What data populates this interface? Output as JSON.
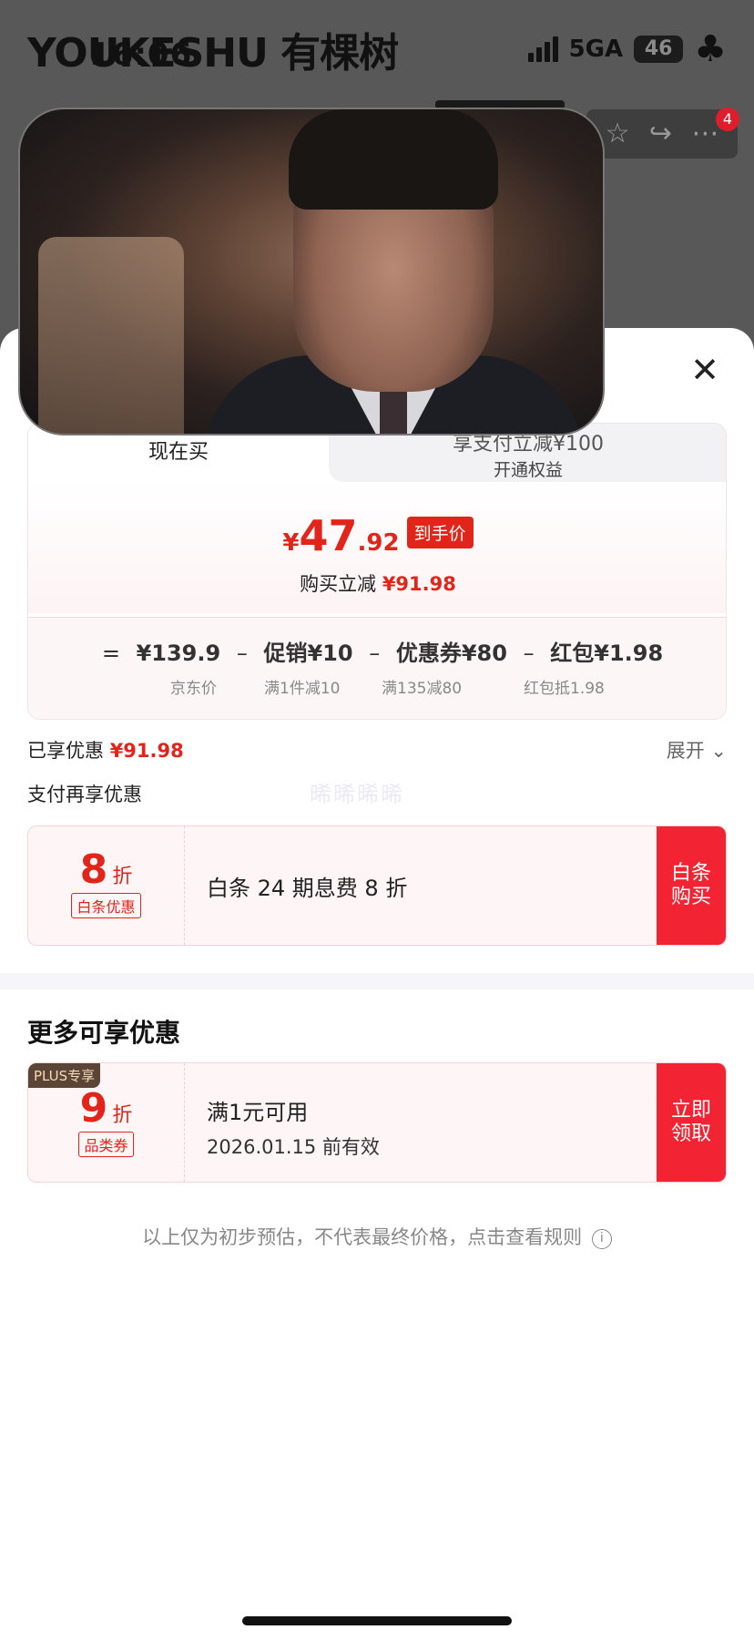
{
  "status_bar": {
    "time": "16:06",
    "network": "5GA",
    "battery": "46"
  },
  "watermark": "YOUKESHU 有棵树",
  "header": {
    "cart_badge": "4"
  },
  "video": {
    "description_icon": "floating-video"
  },
  "tabs": {
    "buy_now": "现在买",
    "pay_discount_title": "享支付立减¥100",
    "pay_discount_sub": "开通权益"
  },
  "price": {
    "currency": "¥",
    "integer": "47",
    "decimal": ".92",
    "tag": "到手价",
    "reduce_label": "购买立减",
    "reduce_amount": "¥91.98"
  },
  "formula": {
    "eq": "=",
    "items": [
      {
        "value": "¥139.9",
        "label": "京东价"
      },
      {
        "value": "促销¥10",
        "label": "满1件减10"
      },
      {
        "value": "优惠券¥80",
        "label": "满135减80"
      },
      {
        "value": "红包¥1.98",
        "label": "红包抵1.98"
      }
    ],
    "minus": "–"
  },
  "enjoyed": {
    "label": "已享优惠",
    "amount": "¥91.98",
    "expand": "展开"
  },
  "pay_again": "支付再享优惠",
  "ghost_text": "晞晞晞晞",
  "baitiao_coupon": {
    "num": "8",
    "unit": "折",
    "tag": "白条优惠",
    "desc": "白条 24 期息费 8 折",
    "cta": "白条购买"
  },
  "more_title": "更多可享优惠",
  "plus_coupon": {
    "badge": "PLUS专享",
    "num": "9",
    "unit": "折",
    "tag": "品类券",
    "line1": "满1元可用",
    "line2": "2026.01.15 前有效",
    "cta": "立即领取"
  },
  "footnote": "以上仅为初步预估，不代表最终价格，点击查看规则",
  "colors": {
    "accent": "#e1251b",
    "cta": "#f22433"
  }
}
